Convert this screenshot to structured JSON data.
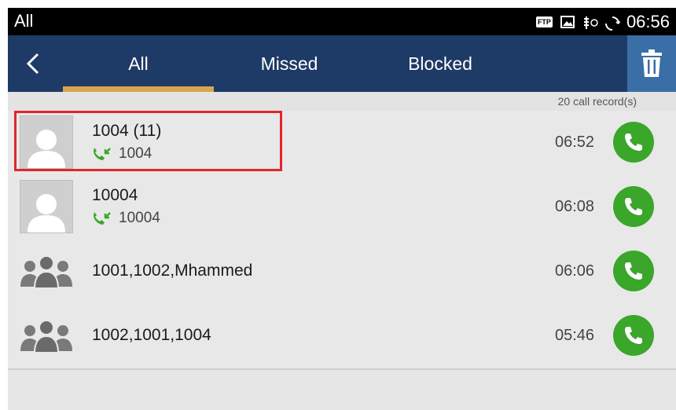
{
  "status_bar": {
    "left_label": "All",
    "ftp_badge": "FTP",
    "time": "06:56",
    "icons": [
      "ftp-icon",
      "image-icon",
      "usb-debug-icon",
      "sync-icon"
    ]
  },
  "app_bar": {
    "back_icon": "back-arrow-icon",
    "tabs": [
      {
        "label": "All",
        "selected": true
      },
      {
        "label": "Missed",
        "selected": false
      },
      {
        "label": "Blocked",
        "selected": false
      }
    ],
    "delete_icon": "trash-icon",
    "indicator_color": "#d9a54c",
    "bar_color": "#1e3a66"
  },
  "record_count": "20 call record(s)",
  "calls": [
    {
      "name": "1004 (11)",
      "number": "1004",
      "time": "06:52",
      "type": "contact",
      "call_type_icon": "incoming-call-icon",
      "highlighted": true
    },
    {
      "name": "10004",
      "number": "10004",
      "time": "06:08",
      "type": "contact",
      "call_type_icon": "incoming-call-icon",
      "highlighted": false
    },
    {
      "name": "1001,1002,Mhammed",
      "time": "06:06",
      "type": "group"
    },
    {
      "name": "1002,1001,1004",
      "time": "05:46",
      "type": "group"
    }
  ],
  "accent_colors": {
    "call_button": "#3aa62a",
    "highlight_box": "#e0262b"
  }
}
